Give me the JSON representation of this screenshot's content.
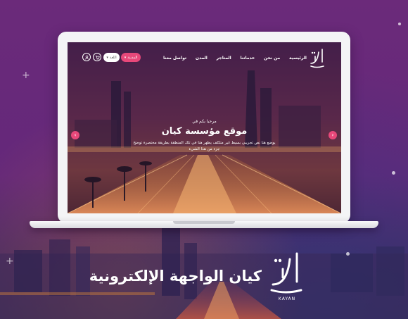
{
  "site": {
    "nav": {
      "links": [
        "الرئيسية",
        "من نحن",
        "خدماتنا",
        "المتاجر",
        "المدن",
        "تواصل معنا"
      ],
      "country_label": "المدينة",
      "lang_label": "اللغة"
    },
    "hero": {
      "welcome": "مرحبا بكم في",
      "title": "موقع مؤسسة كيان",
      "description_line1": "يوضع هنا نص تجريبي بسيط غير متكلف يظهر هنا في تلك المنطقة بطريقة مختصرة توضح",
      "description_line2": "جزء من هذا الشيء"
    }
  },
  "brand": {
    "title": "كيان الواجهة الإلكترونية",
    "logo_subtext": "KAYAN"
  },
  "colors": {
    "background": "#6a2a78",
    "accent": "#e8487a",
    "laptop": "#f4f4f6"
  }
}
